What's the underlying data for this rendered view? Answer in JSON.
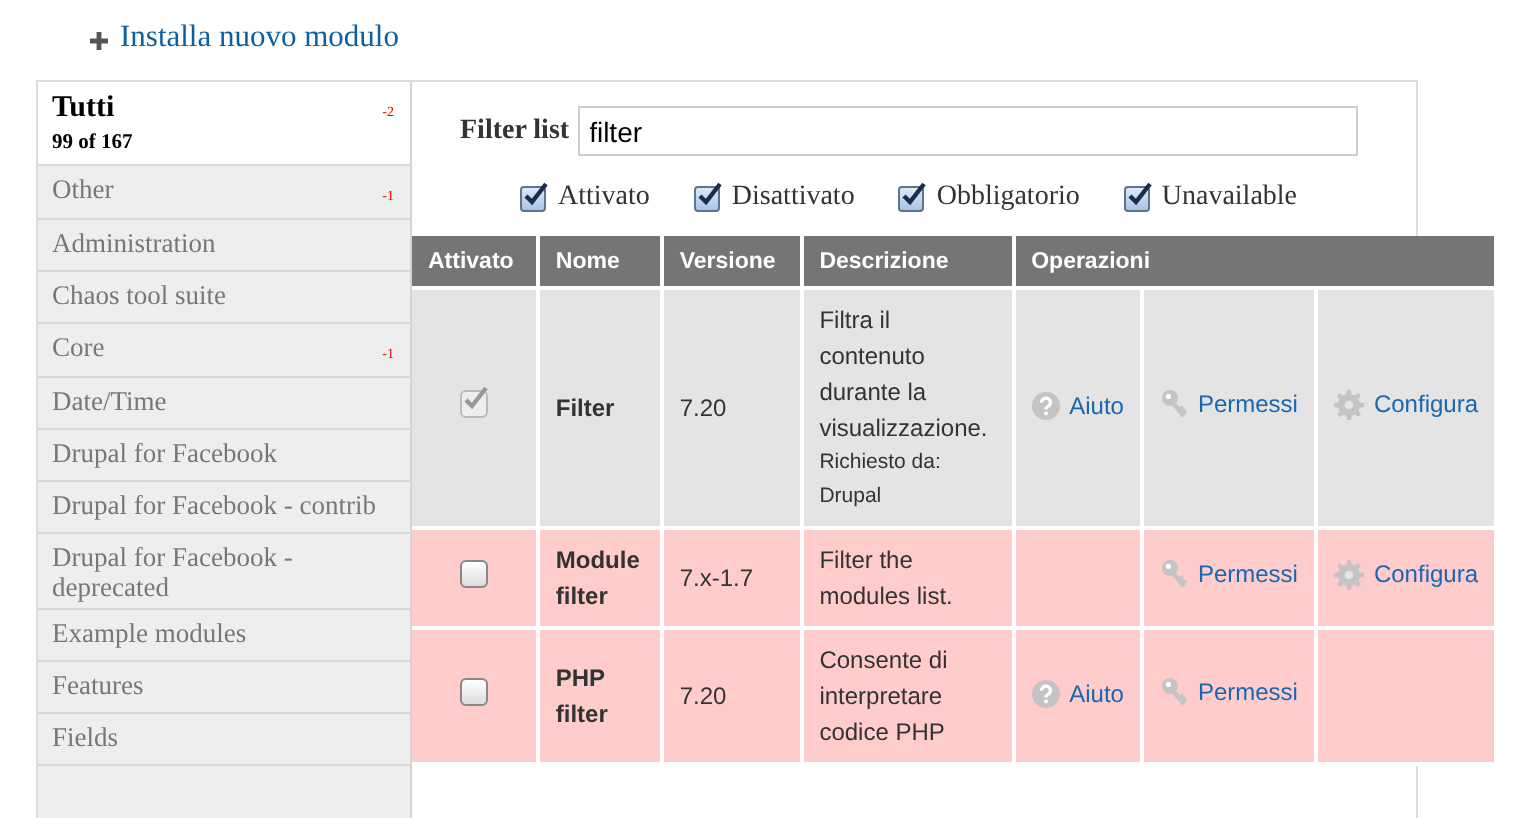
{
  "install_link": {
    "label": "Installa nuovo modulo"
  },
  "sidebar": {
    "items": [
      {
        "label": "Tutti",
        "subtitle": "99 of 167",
        "count": "-2",
        "selected": true
      },
      {
        "label": "Other",
        "count": "-1",
        "selected": false
      },
      {
        "label": "Administration",
        "selected": false
      },
      {
        "label": "Chaos tool suite",
        "selected": false
      },
      {
        "label": "Core",
        "count": "-1",
        "selected": false
      },
      {
        "label": "Date/Time",
        "selected": false
      },
      {
        "label": "Drupal for Facebook",
        "selected": false
      },
      {
        "label": "Drupal for Facebook - contrib",
        "selected": false
      },
      {
        "label": "Drupal for Facebook - deprecated",
        "selected": false
      },
      {
        "label": "Example modules",
        "selected": false
      },
      {
        "label": "Features",
        "selected": false
      },
      {
        "label": "Fields",
        "selected": false
      }
    ]
  },
  "filter": {
    "label": "Filter list",
    "value": "filter"
  },
  "status_filters": [
    {
      "label": "Attivato",
      "checked": true
    },
    {
      "label": "Disattivato",
      "checked": true
    },
    {
      "label": "Obbligatorio",
      "checked": true
    },
    {
      "label": "Unavailable",
      "checked": true
    }
  ],
  "table": {
    "columns": [
      "Attivato",
      "Nome",
      "Versione",
      "Descrizione",
      "Operazioni"
    ],
    "rows": [
      {
        "kind": "enabled",
        "checked": true,
        "disabled": true,
        "name": "Filter",
        "version": "7.20",
        "description": "Filtra il contenuto durante la visualizzazione.",
        "required_by": "Richiesto da: Drupal",
        "operations": [
          {
            "kind": "help",
            "label": "Aiuto"
          },
          {
            "kind": "permissions",
            "label": "Permessi"
          },
          {
            "kind": "configure",
            "label": "Configura"
          }
        ]
      },
      {
        "kind": "disabled",
        "checked": false,
        "disabled": false,
        "name": "Module filter",
        "version": "7.x-1.7",
        "description": "Filter the modules list.",
        "operations": [
          {
            "kind": "permissions",
            "label": "Permessi"
          },
          {
            "kind": "configure",
            "label": "Configura"
          }
        ]
      },
      {
        "kind": "disabled",
        "checked": false,
        "disabled": false,
        "name": "PHP filter",
        "version": "7.20",
        "description": "Consente di interpretare codice PHP",
        "operations": [
          {
            "kind": "help",
            "label": "Aiuto"
          },
          {
            "kind": "permissions",
            "label": "Permessi"
          }
        ]
      }
    ]
  }
}
